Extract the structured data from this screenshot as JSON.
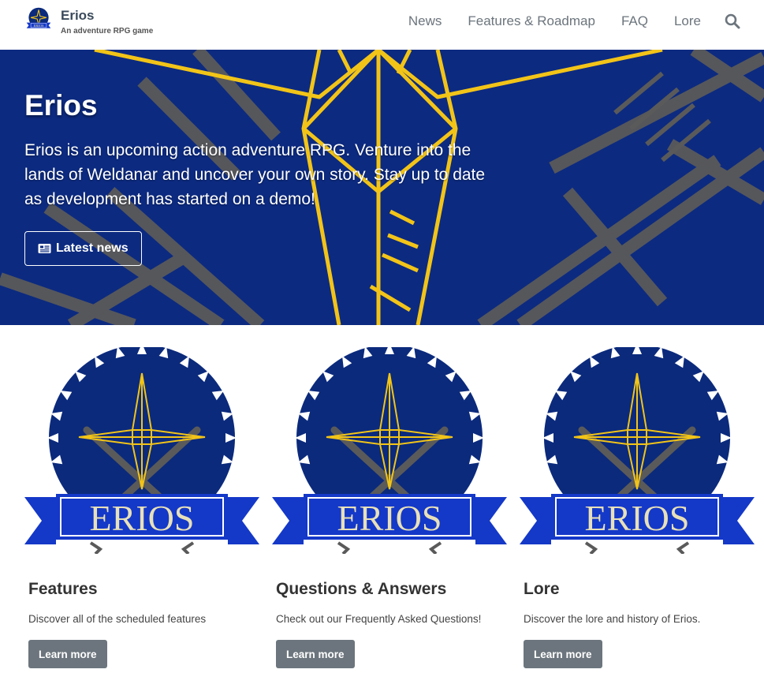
{
  "brand": {
    "name": "Erios",
    "tagline": "An adventure RPG game",
    "logo_icon": "erios-emblem-icon"
  },
  "nav": {
    "links": [
      "News",
      "Features & Roadmap",
      "FAQ",
      "Lore"
    ],
    "search_icon": "search-icon"
  },
  "hero": {
    "title": "Erios",
    "description": "Erios is an upcoming action adventure RPG. Venture into the lands of Weldanar and uncover your own story. Stay up to date as development has started on a demo!",
    "button_label": "Latest news",
    "button_icon": "newspaper-icon"
  },
  "cards": [
    {
      "title": "Features",
      "text": "Discover all of the scheduled features",
      "button": "Learn more",
      "logo_text": "ERIOS"
    },
    {
      "title": "Questions & Answers",
      "text": "Check out our Frequently Asked Questions!",
      "button": "Learn more",
      "logo_text": "ERIOS"
    },
    {
      "title": "Lore",
      "text": "Discover the lore and history of Erios.",
      "button": "Learn more",
      "logo_text": "ERIOS"
    }
  ],
  "colors": {
    "hero_bg": "#0c2a80",
    "emblem_navy": "#0b2a7c",
    "ribbon_blue": "#1438c8",
    "gold": "#f2c418",
    "steel": "#5a5a5a",
    "button_gray": "#6c757d"
  }
}
